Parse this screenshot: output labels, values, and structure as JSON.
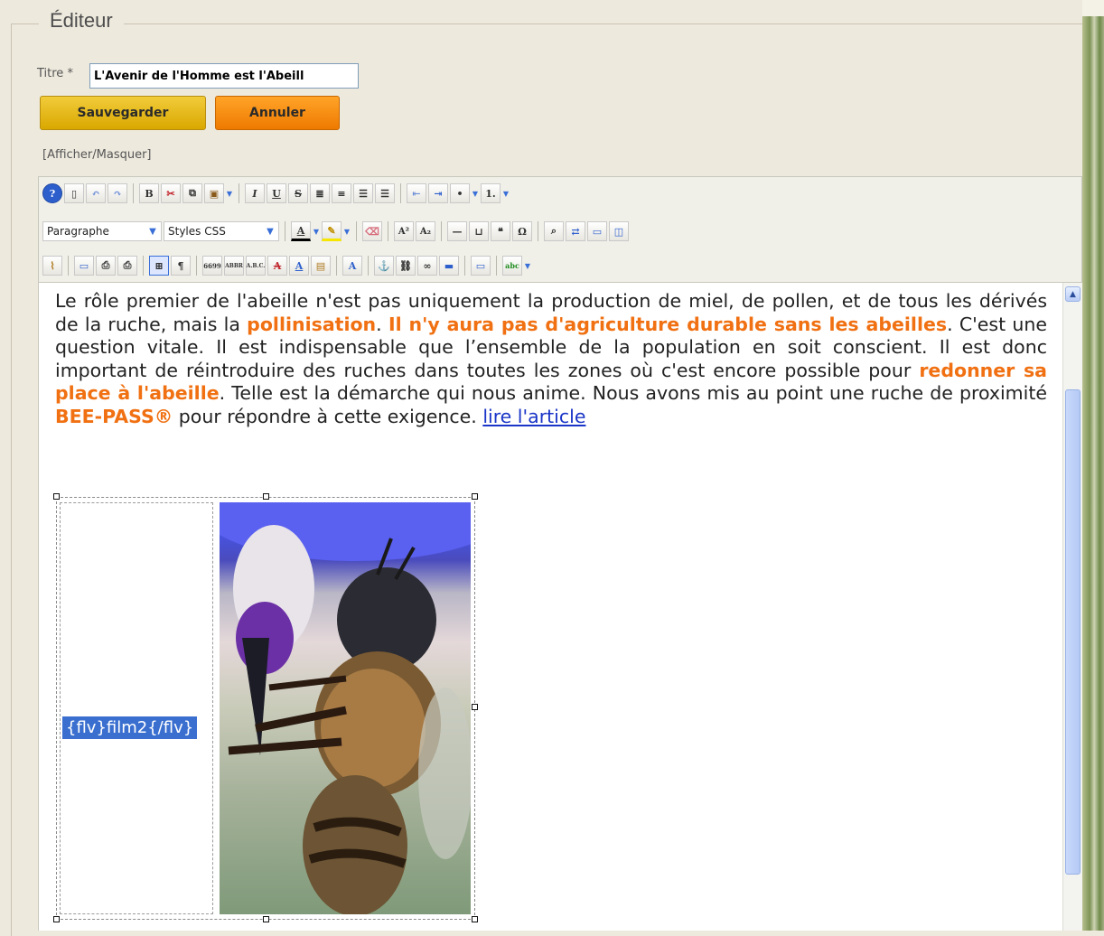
{
  "editor": {
    "legend": "Éditeur",
    "title_label": "Titre *",
    "title_value": "L'Avenir de l'Homme est l'Abeill",
    "save_label": "Sauvegarder",
    "cancel_label": "Annuler",
    "toggle_label": "[Afficher/Masquer]"
  },
  "toolbar": {
    "format_select": "Paragraphe",
    "styles_select": "Styles CSS",
    "icons_row1": [
      "help-icon",
      "new-doc-icon",
      "undo-icon",
      "redo-icon",
      "bold-icon",
      "cut-icon",
      "copy-icon",
      "paste-icon",
      "italic-icon",
      "underline-icon",
      "strikethrough-icon",
      "justify-icon",
      "align-center-icon",
      "align-left-icon",
      "align-right-icon",
      "outdent-icon",
      "indent-icon",
      "bullet-list-icon",
      "numbered-list-icon"
    ],
    "glyphs": {
      "bold": "B",
      "italic": "I",
      "underline": "U",
      "strike": "S",
      "superscript": "A²",
      "subscript": "A₂",
      "omega": "Ω",
      "quote": "❝",
      "pilcrow": "¶",
      "font_color": "A",
      "abbr1": "6699",
      "abbr2": "ABBR",
      "abbr3": "A.B.C.",
      "spell": "abc"
    }
  },
  "content": {
    "part1": "Le rôle premier de l'abeille n'est pas uniquement la production de miel, de pollen, et de tous les dérivés de la ruche, mais la ",
    "hl1": "pollinisation",
    "part2": ". ",
    "hl2": "Il n'y aura pas d'agriculture durable sans les abeilles",
    "part3": ". C'est une question vitale. Il est indispensable que l’ensemble de la population en soit conscient. Il est donc important de réintroduire des ruches dans toutes les zones où c'est encore possible pour ",
    "hl3": "redonner sa place à l'abeille",
    "part4": ". Telle est la démarche qui nous anime. Nous avons mis au point une ruche de proximité ",
    "hl4": "BEE-PASS®",
    "part5": " pour répondre à cette exigence. ",
    "link": "lire l'article",
    "flv_tag": "{flv}film2{/flv}"
  }
}
